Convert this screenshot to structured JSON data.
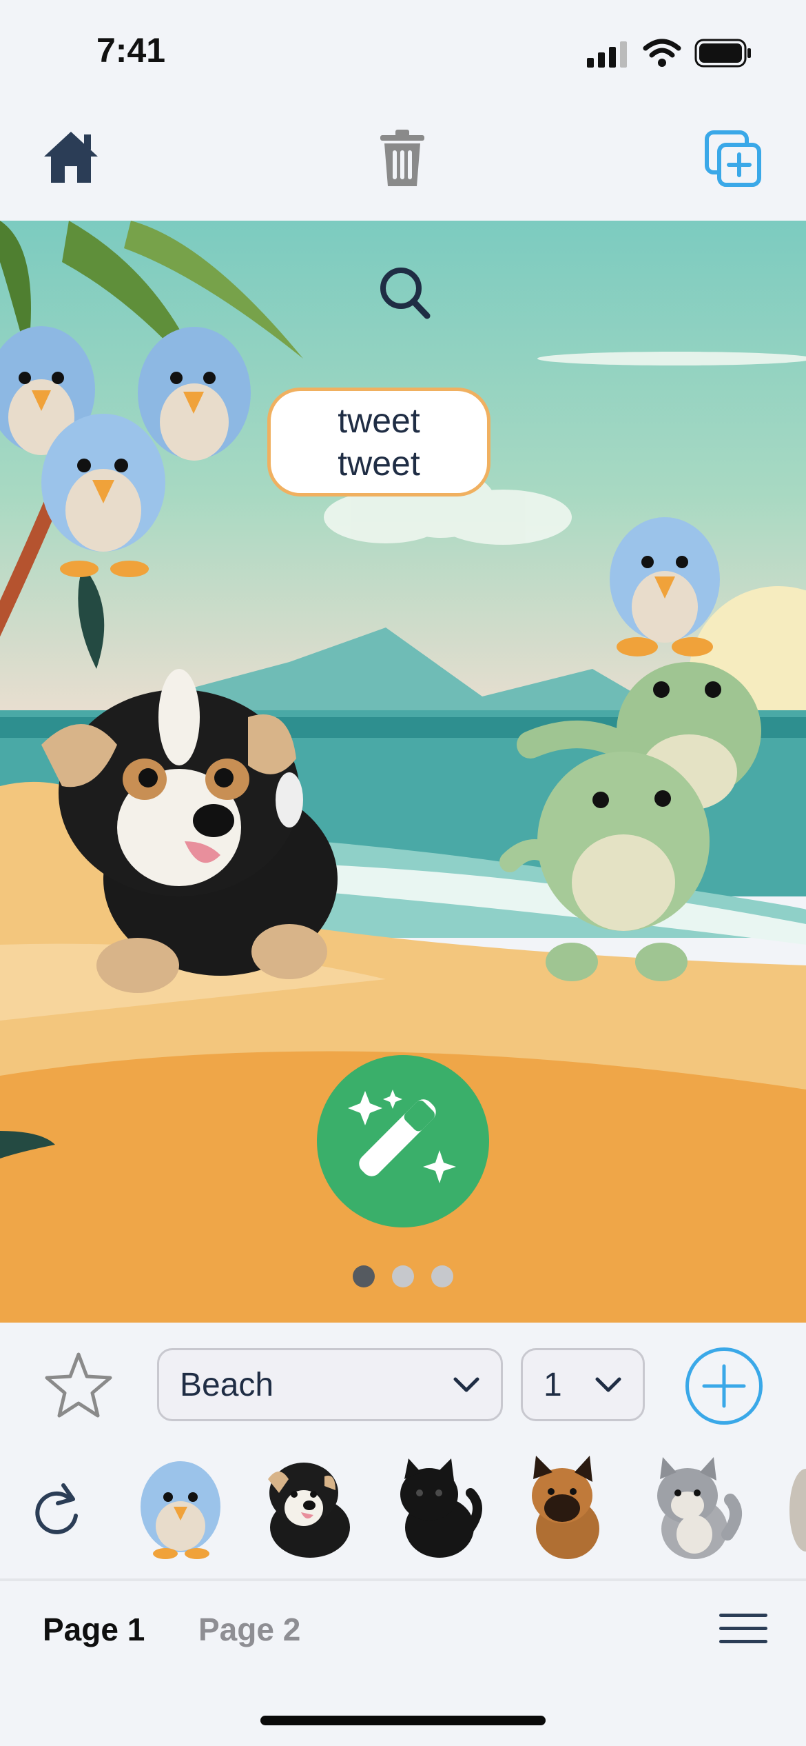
{
  "status_bar": {
    "time": "7:41"
  },
  "toolbar": {
    "home_icon": "home-icon",
    "delete_icon": "trash-icon",
    "new_page_icon": "copy-add-icon"
  },
  "scene": {
    "background": "beach",
    "speech_bubble": {
      "line1": "tweet",
      "line2": "tweet"
    },
    "search_icon": "search-icon",
    "magic_icon": "magic-wand-icon",
    "page_dots": {
      "count": 3,
      "active": 1
    }
  },
  "controls": {
    "scene_select": {
      "value": "Beach"
    },
    "count_select": {
      "value": "1"
    },
    "favorite_icon": "star-icon",
    "add_icon": "plus-circle-icon"
  },
  "sticker_tray": {
    "refresh_icon": "refresh-icon",
    "items": [
      "blue bird plush",
      "puppy plush",
      "black cat plush",
      "shepherd puppy plush",
      "husky plush"
    ]
  },
  "bottom_bar": {
    "tabs": [
      "Page 1",
      "Page 2"
    ],
    "active_tab": 0,
    "menu_icon": "hamburger-menu-icon"
  },
  "colors": {
    "accent_blue": "#3aa8e8",
    "magic_green": "#3aaf6a",
    "bubble_border": "#f0b060",
    "ink": "#1f2d44"
  }
}
